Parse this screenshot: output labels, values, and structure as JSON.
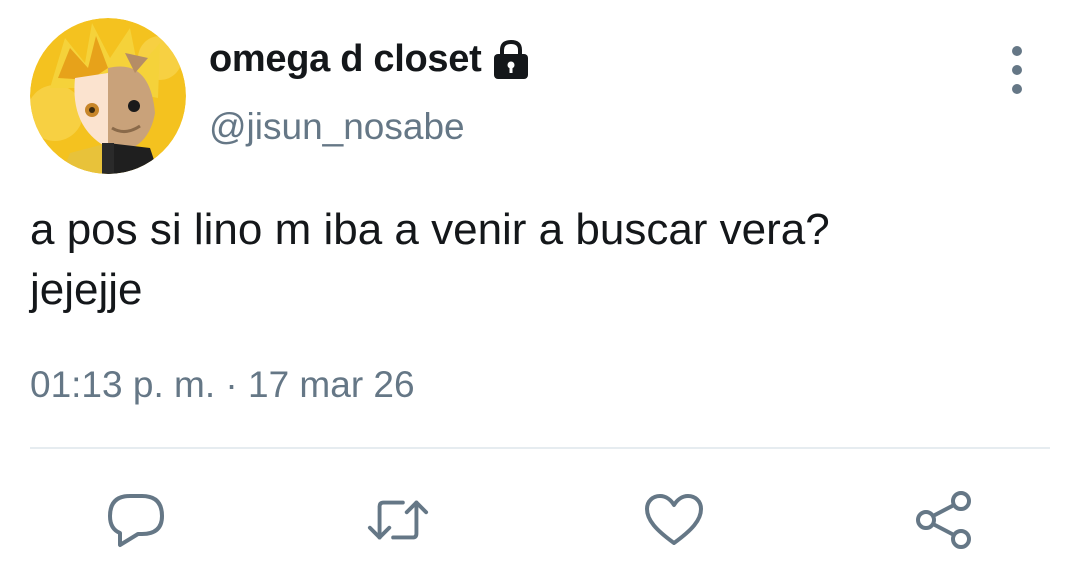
{
  "user": {
    "display_name": "omega d closet",
    "handle": "@jisun_nosabe",
    "protected_icon": "lock-icon",
    "avatar": "profile-avatar"
  },
  "tweet": {
    "text_line1": "a pos si lino m iba a venir a buscar vera?",
    "text_line2": "jejejje",
    "timestamp": "01:13 p. m. · 17 mar 26"
  },
  "actions": {
    "more": "more-options-icon",
    "reply": "reply-icon",
    "retweet": "retweet-icon",
    "like": "heart-icon",
    "share": "share-icon"
  },
  "colors": {
    "primary_text": "#14171a",
    "secondary_text": "#657786",
    "divider": "#e6ecf0"
  }
}
